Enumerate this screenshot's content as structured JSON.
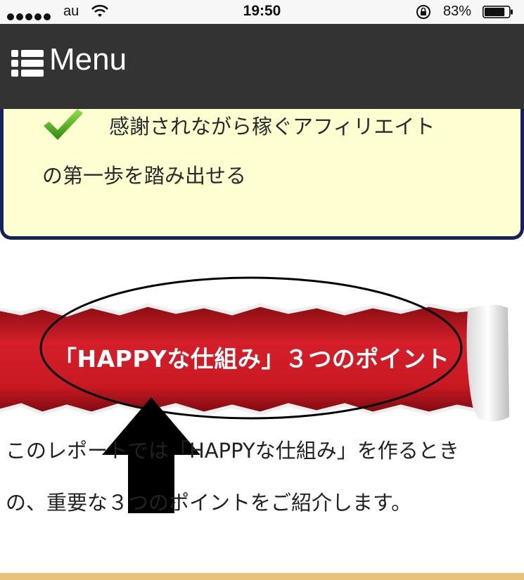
{
  "status_bar": {
    "carrier": "au",
    "time": "19:50",
    "battery_percent": "83%",
    "battery_level": 0.83
  },
  "header": {
    "menu_label": "Menu"
  },
  "info_box": {
    "line1": "感謝されながら稼ぐアフィリエイト",
    "line2": "の第一歩を踏み出せる"
  },
  "ribbon": {
    "title": "「HAPPYな仕組み」３つのポイント"
  },
  "body": {
    "line1": "このレポートでは「HAPPYな仕組み」を作るとき",
    "line2": "の、重要な３つのポイントをご紹介します。"
  },
  "colors": {
    "header_bg": "#333333",
    "info_bg": "#ffffd2",
    "info_border": "#16205a",
    "ribbon_red": "#d41f2a",
    "bottom_stripe": "#e8c27a"
  }
}
